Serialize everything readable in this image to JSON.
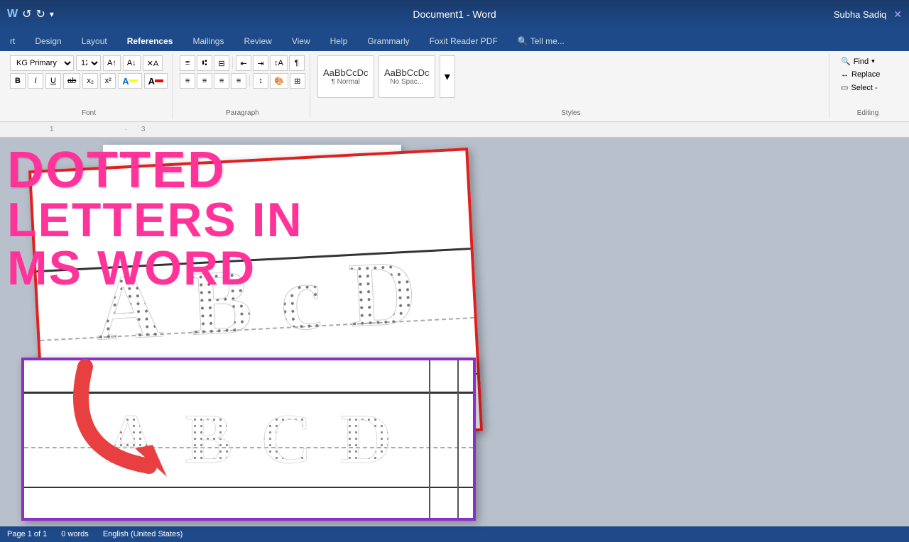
{
  "titleBar": {
    "title": "Document1 - Word",
    "user": "Subha Sadiq",
    "undoLabel": "↺",
    "redoLabel": "↻"
  },
  "ribbonTabs": {
    "tabs": [
      {
        "label": "rt",
        "active": false
      },
      {
        "label": "Design",
        "active": false
      },
      {
        "label": "Layout",
        "active": false
      },
      {
        "label": "References",
        "active": false
      },
      {
        "label": "Mailings",
        "active": false
      },
      {
        "label": "Review",
        "active": false
      },
      {
        "label": "View",
        "active": false
      },
      {
        "label": "Help",
        "active": false
      },
      {
        "label": "Grammarly",
        "active": false
      },
      {
        "label": "Foxit Reader PDF",
        "active": false
      },
      {
        "label": "Tell me...",
        "active": false
      }
    ]
  },
  "ribbon": {
    "fontName": "KG Primary Do",
    "fontSize": "12",
    "boldLabel": "B",
    "italicLabel": "I",
    "underlineLabel": "U",
    "strikeLabel": "ab",
    "superLabel": "x²",
    "subLabel": "x₂",
    "fontColorLabel": "A",
    "highlightLabel": "A",
    "fontGroupLabel": "Font",
    "paragraphGroupLabel": "Paragraph",
    "stylesGroupLabel": "Styles",
    "normalLabel": "¶ Normal",
    "noSpaceLabel": "No Spac...",
    "findLabel": "Find",
    "replaceLabel": "Replace",
    "selectLabel": "Select -",
    "editingLabel": "Editing"
  },
  "overlay": {
    "line1": "DOTTED",
    "line2": "LETTERS IN",
    "line3": "MS WORD"
  },
  "docLetters": {
    "letters": [
      "A",
      "B",
      "C"
    ]
  },
  "previewRed": {
    "letters": [
      "A",
      "B",
      "C",
      "D"
    ]
  },
  "previewPurple": {
    "letters": [
      "A",
      "B",
      "C",
      "D"
    ]
  },
  "statusBar": {
    "pageInfo": "Page 1 of 1",
    "wordCount": "0 words",
    "lang": "English (United States)"
  }
}
